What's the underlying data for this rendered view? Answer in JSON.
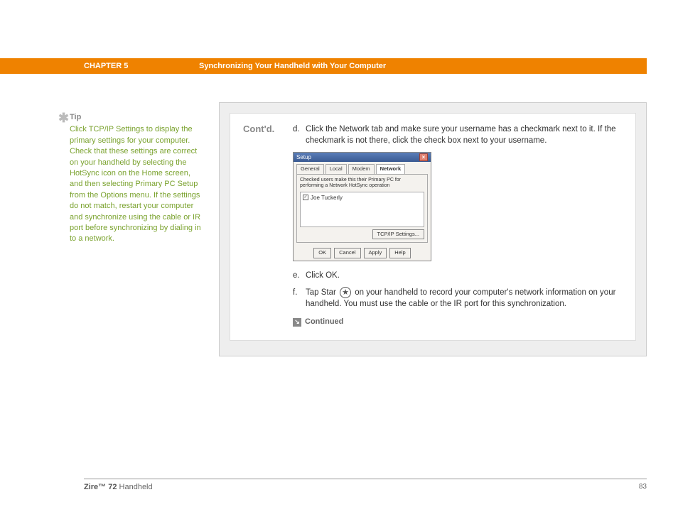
{
  "header": {
    "chapter": "CHAPTER 5",
    "title": "Synchronizing Your Handheld with Your Computer"
  },
  "sidebar": {
    "tip_label": "Tip",
    "tip_text": "Click TCP/IP Settings to display the primary settings for your computer. Check that these settings are correct on your handheld by selecting the HotSync icon on the Home screen, and then selecting Primary PC Setup from the Options menu. If the settings do not match, restart your computer and synchronize using the cable or IR port before synchronizing by dialing in to a network."
  },
  "main": {
    "contd": "Cont'd.",
    "step_d_letter": "d.",
    "step_d_text": "Click the Network tab and make sure your username has a checkmark next to it. If the checkmark is not there, click the check box next to your username.",
    "step_e_letter": "e.",
    "step_e_text": "Click OK.",
    "step_f_letter": "f.",
    "step_f_text_before": "Tap Star ",
    "step_f_text_after": " on your handheld to record your computer's network information on your handheld. You must use the cable or the IR port for this synchronization.",
    "continued": "Continued"
  },
  "dialog": {
    "title": "Setup",
    "tabs": [
      "General",
      "Local",
      "Modem",
      "Network"
    ],
    "hint": "Checked users make this their Primary PC for performing a Network HotSync operation",
    "user": "Joe Tuckerly",
    "tcpip_btn": "TCP/IP Settings...",
    "buttons": [
      "OK",
      "Cancel",
      "Apply",
      "Help"
    ]
  },
  "footer": {
    "brand_bold": "Zire™ 72",
    "brand_rest": " Handheld",
    "page": "83"
  }
}
